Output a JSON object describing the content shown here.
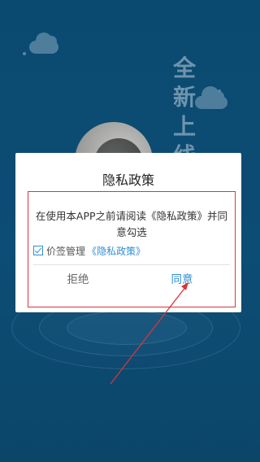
{
  "background": {
    "vertical_title": [
      "全",
      "新",
      "上",
      "线"
    ],
    "primary_color": "#0c4b73"
  },
  "dialog": {
    "title": "隐私政策",
    "message": "在使用本APP之前请阅读《隐私政策》并同意勾选",
    "consent": {
      "checked": true,
      "label": "价签管理",
      "link_text": "《隐私政策》"
    },
    "buttons": {
      "reject_label": "拒绝",
      "agree_label": "同意"
    },
    "accent_color": "#2e8fd6",
    "highlight_color": "#d9343a"
  }
}
